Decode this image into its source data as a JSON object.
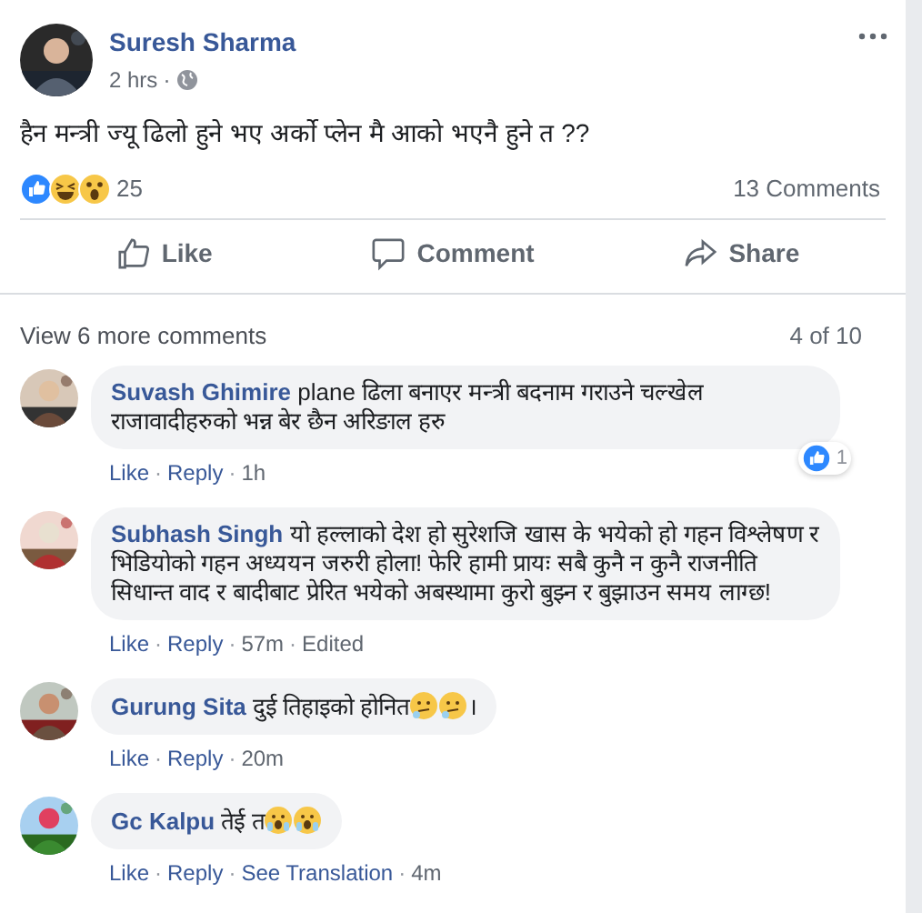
{
  "post": {
    "author": "Suresh Sharma",
    "time": "2 hrs",
    "separator": "·",
    "text": "हैन मन्त्री ज्यू ढिलो हुने भए अर्को प्लेन मै आको भएनै हुने त ??",
    "reaction_count": "25",
    "comments_count": "13 Comments",
    "actions": [
      {
        "kind": "like",
        "label": "Like"
      },
      {
        "kind": "comment",
        "label": "Comment"
      },
      {
        "kind": "share",
        "label": "Share"
      }
    ]
  },
  "comments_section": {
    "view_more": "View 6 more comments",
    "pager": "4 of 10",
    "separator": "·",
    "comments": [
      {
        "author": "Suvash Ghimire",
        "text": "plane ढिला बनाएर मन्त्री बदनाम गराउने चल्खेल राजावादीहरुको भन्न बेर छैन अरिङाल हरु",
        "reaction": {
          "count": "1"
        },
        "meta": [
          {
            "kind": "link",
            "label": "Like"
          },
          {
            "kind": "link",
            "label": "Reply"
          },
          {
            "kind": "time",
            "label": "1h"
          }
        ]
      },
      {
        "author": "Subhash Singh",
        "text": "यो हल्लाको देश हो सुरेशजि खास के भयेको हो गहन विश्लेषण र भिडियोको गहन अध्ययन जरुरी होला! फेरि हामी प्रायः सबै कुनै न कुनै राजनीति सिधान्त वाद र बादीबाट प्रेरित भयेको अबस्थामा कुरो बुझ्न र बुझाउन समय लाग्छ!",
        "meta": [
          {
            "kind": "link",
            "label": "Like"
          },
          {
            "kind": "link",
            "label": "Reply"
          },
          {
            "kind": "time",
            "label": "57m"
          },
          {
            "kind": "time",
            "label": "Edited"
          }
        ]
      },
      {
        "author": "Gurung Sita",
        "text": "दुई तिहाइको होनित",
        "emojis": [
          {
            "kind": "thinking"
          },
          {
            "kind": "thinking"
          }
        ],
        "after": "।",
        "meta": [
          {
            "kind": "link",
            "label": "Like"
          },
          {
            "kind": "link",
            "label": "Reply"
          },
          {
            "kind": "time",
            "label": "20m"
          }
        ]
      },
      {
        "author": "Gc Kalpu",
        "text": "तेई त",
        "emojis": [
          {
            "kind": "surprised"
          },
          {
            "kind": "surprised"
          }
        ],
        "meta": [
          {
            "kind": "link",
            "label": "Like"
          },
          {
            "kind": "link",
            "label": "Reply"
          },
          {
            "kind": "link",
            "label": "See Translation"
          },
          {
            "kind": "time",
            "label": "4m"
          }
        ]
      }
    ]
  }
}
